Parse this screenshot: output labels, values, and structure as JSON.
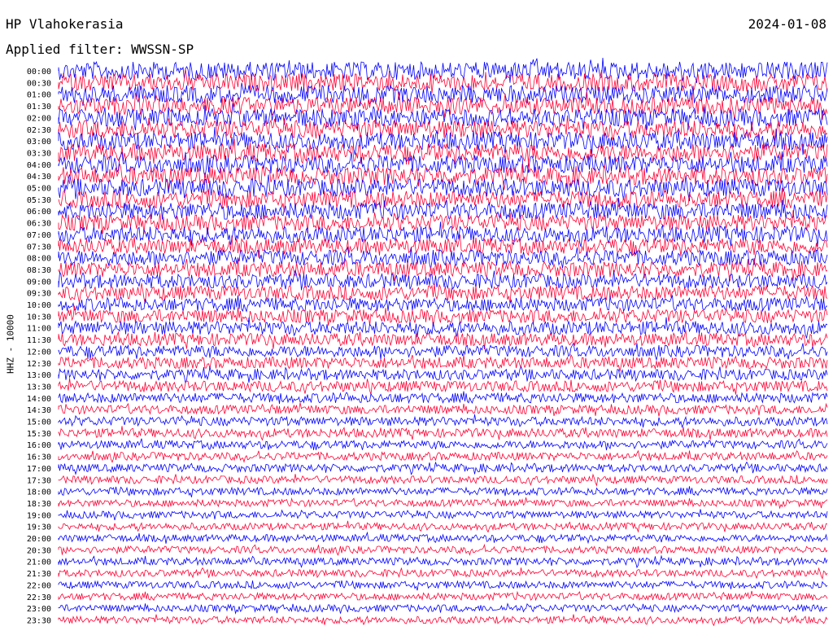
{
  "header": {
    "station": "HP Vlahokerasia",
    "date": "2024-01-08",
    "filter": "Applied filter: WWSSN-SP",
    "channel": "HHZ - 10000"
  },
  "colors": {
    "trace_a": "#0000ff",
    "trace_b": "#ff0033",
    "text": "#000000"
  },
  "chart_data": {
    "type": "line",
    "title": "HP Vlahokerasia",
    "ylabel": "HHZ - 10000",
    "tick_labels": [
      "00:00",
      "00:30",
      "01:00",
      "01:30",
      "02:00",
      "02:30",
      "03:00",
      "03:30",
      "04:00",
      "04:30",
      "05:00",
      "05:30",
      "06:00",
      "06:30",
      "07:00",
      "07:30",
      "08:00",
      "08:30",
      "09:00",
      "09:30",
      "10:00",
      "10:30",
      "11:00",
      "11:30",
      "12:00",
      "12:30",
      "13:00",
      "13:30",
      "14:00",
      "14:30",
      "15:00",
      "15:30",
      "16:00",
      "16:30",
      "17:00",
      "17:30",
      "18:00",
      "18:30",
      "19:00",
      "19:30",
      "20:00",
      "20:30",
      "21:00",
      "21:30",
      "22:00",
      "22:30",
      "23:00",
      "23:30"
    ],
    "series_colors_alternating": [
      "blue",
      "red"
    ],
    "relative_amplitude": [
      1.0,
      1.0,
      1.0,
      1.0,
      1.0,
      1.0,
      1.0,
      1.0,
      1.0,
      1.0,
      1.0,
      0.95,
      0.95,
      0.9,
      0.9,
      0.85,
      0.85,
      0.85,
      0.8,
      0.8,
      0.75,
      0.75,
      0.75,
      0.7,
      0.65,
      0.65,
      0.6,
      0.6,
      0.55,
      0.5,
      0.5,
      0.5,
      0.45,
      0.45,
      0.45,
      0.42,
      0.42,
      0.4,
      0.4,
      0.4,
      0.4,
      0.4,
      0.42,
      0.4,
      0.4,
      0.4,
      0.4,
      0.4
    ]
  }
}
